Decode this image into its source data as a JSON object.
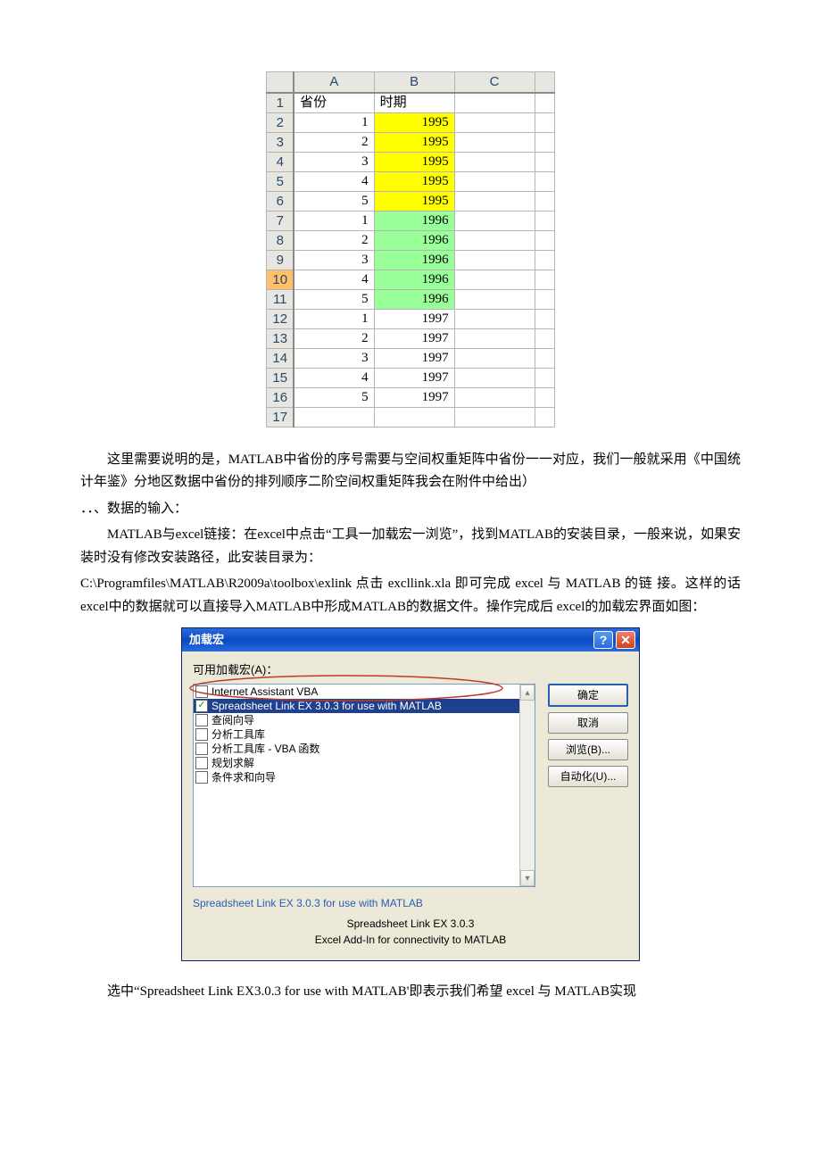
{
  "spreadsheet": {
    "cols": [
      "A",
      "B",
      "C",
      ""
    ],
    "header_row": {
      "a": "省份",
      "b": "时期"
    },
    "rows": [
      {
        "n": "1",
        "a": "省份",
        "b": "时期",
        "txt": true
      },
      {
        "n": "2",
        "a": "1",
        "b": "1995",
        "color": "yellow"
      },
      {
        "n": "3",
        "a": "2",
        "b": "1995",
        "color": "yellow"
      },
      {
        "n": "4",
        "a": "3",
        "b": "1995",
        "color": "yellow"
      },
      {
        "n": "5",
        "a": "4",
        "b": "1995",
        "color": "yellow"
      },
      {
        "n": "6",
        "a": "5",
        "b": "1995",
        "color": "yellow"
      },
      {
        "n": "7",
        "a": "1",
        "b": "1996",
        "color": "green"
      },
      {
        "n": "8",
        "a": "2",
        "b": "1996",
        "color": "green"
      },
      {
        "n": "9",
        "a": "3",
        "b": "1996",
        "color": "green"
      },
      {
        "n": "10",
        "a": "4",
        "b": "1996",
        "color": "green",
        "sel": true
      },
      {
        "n": "11",
        "a": "5",
        "b": "1996",
        "color": "green"
      },
      {
        "n": "12",
        "a": "1",
        "b": "1997",
        "color": "white"
      },
      {
        "n": "13",
        "a": "2",
        "b": "1997",
        "color": "white"
      },
      {
        "n": "14",
        "a": "3",
        "b": "1997",
        "color": "white"
      },
      {
        "n": "15",
        "a": "4",
        "b": "1997",
        "color": "white"
      },
      {
        "n": "16",
        "a": "5",
        "b": "1997",
        "color": "white"
      },
      {
        "n": "17",
        "a": "",
        "b": "",
        "color": "blank"
      }
    ]
  },
  "para1": "这里需要说明的是，MATLAB中省份的序号需要与空间权重矩阵中省份一一对应，我们一般就采用《中国统计年鉴》分地区数据中省份的排列顺序二阶空间权重矩阵我会在附件中给出）",
  "para2": "．．、数据的输入：",
  "para3a": "MATLAB与excel链接：在excel中点击“工具一加载宏一浏览”，找到MATLAB的安装目录，一般来说，如果安装时没有修改安装路径，此安装目录为：",
  "para3b": "C:\\Programfiles\\MATLAB\\R2009a\\toolbox\\exlink 点击  excllink.xla 即可完成  excel 与  MATLAB 的链 接。这样的话excel中的数据就可以直接导入MATLAB中形成MATLAB的数据文件。操作完成后  excel的加载宏界面如图：",
  "dialog": {
    "title": "加载宏",
    "available_label": "可用加载宏(A)：",
    "items": [
      {
        "label": "Internet Assistant VBA",
        "checked": false,
        "sel": false
      },
      {
        "label": "Spreadsheet Link EX 3.0.3 for use with MATLAB",
        "checked": true,
        "sel": true
      },
      {
        "label": "查阅向导",
        "checked": false
      },
      {
        "label": "分析工具库",
        "checked": false
      },
      {
        "label": "分析工具库 - VBA 函数",
        "checked": false
      },
      {
        "label": "规划求解",
        "checked": false
      },
      {
        "label": "条件求和向导",
        "checked": false
      }
    ],
    "buttons": {
      "ok": "确定",
      "cancel": "取消",
      "browse": "浏览(B)...",
      "auto": "自动化(U)..."
    },
    "desc_title": "Spreadsheet Link EX 3.0.3 for use with MATLAB",
    "desc_line1": "Spreadsheet Link EX 3.0.3",
    "desc_line2": "Excel Add-In for connectivity to MATLAB"
  },
  "para4": "选中“Spreadsheet Link EX3.0.3 for use with MATLAB'即表示我们希望  excel 与  MATLAB实现"
}
